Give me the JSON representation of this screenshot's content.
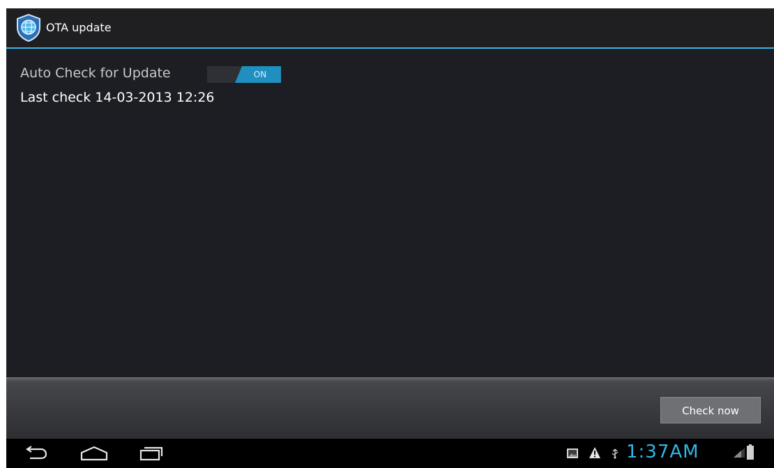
{
  "app": {
    "title": "OTA update",
    "icon": "globe-shield-icon",
    "accent_color": "#33b5e5"
  },
  "settings": {
    "auto_check": {
      "label": "Auto Check for Update",
      "toggle_state": "ON"
    },
    "last_check": "Last check 14-03-2013 12:26"
  },
  "actions": {
    "check_now_label": "Check now"
  },
  "system_bar": {
    "nav_icons": [
      "back-icon",
      "home-icon",
      "recent-apps-icon"
    ],
    "status_icons": [
      "gallery-icon",
      "warning-icon",
      "usb-icon",
      "signal-icon",
      "battery-icon"
    ],
    "clock": "1:37AM",
    "clock_color": "#33b5e5"
  }
}
